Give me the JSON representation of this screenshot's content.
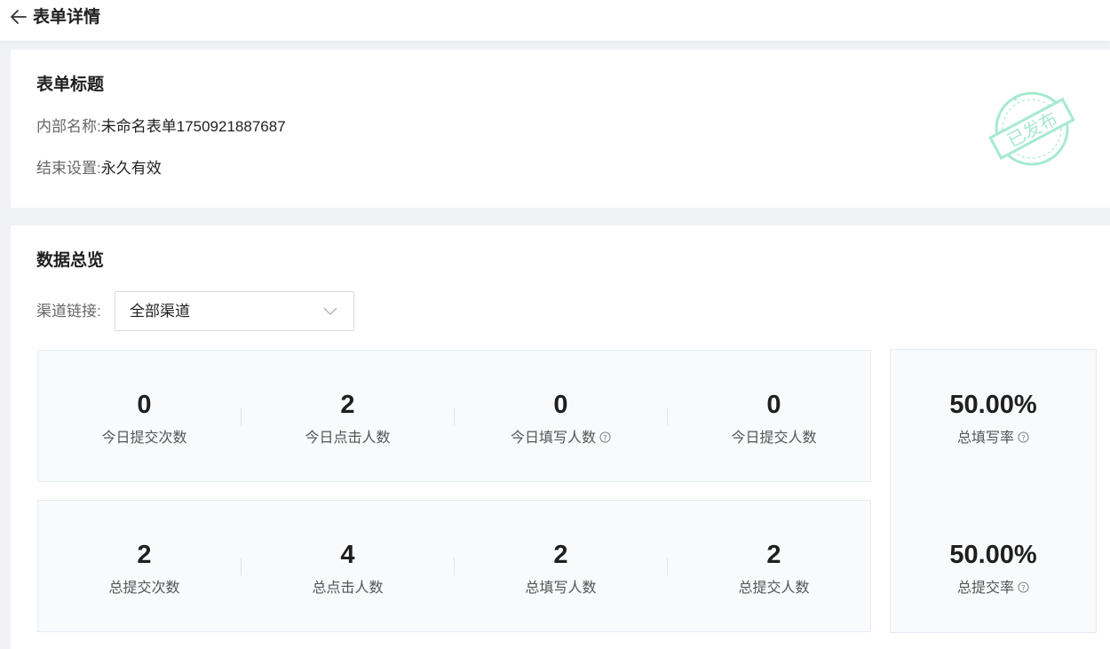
{
  "header": {
    "title": "表单详情",
    "back_icon": "arrow-left-icon"
  },
  "form_info": {
    "title": "表单标题",
    "internal_name_label": "内部名称:",
    "internal_name_value": "未命名表单1750921887687",
    "end_setting_label": "结束设置:",
    "end_setting_value": "永久有效",
    "status_stamp": "已发布",
    "stamp_color": "#5fd9a8"
  },
  "overview": {
    "title": "数据总览",
    "channel_label": "渠道链接:",
    "channel_value": "全部渠道",
    "today": [
      {
        "value": "0",
        "label": "今日提交次数",
        "help": false
      },
      {
        "value": "2",
        "label": "今日点击人数",
        "help": false
      },
      {
        "value": "0",
        "label": "今日填写人数",
        "help": true
      },
      {
        "value": "0",
        "label": "今日提交人数",
        "help": false
      }
    ],
    "total": [
      {
        "value": "2",
        "label": "总提交次数"
      },
      {
        "value": "4",
        "label": "总点击人数"
      },
      {
        "value": "2",
        "label": "总填写人数"
      },
      {
        "value": "2",
        "label": "总提交人数"
      }
    ],
    "rates": [
      {
        "value": "50.00%",
        "label": "总填写率"
      },
      {
        "value": "50.00%",
        "label": "总提交率"
      }
    ]
  }
}
